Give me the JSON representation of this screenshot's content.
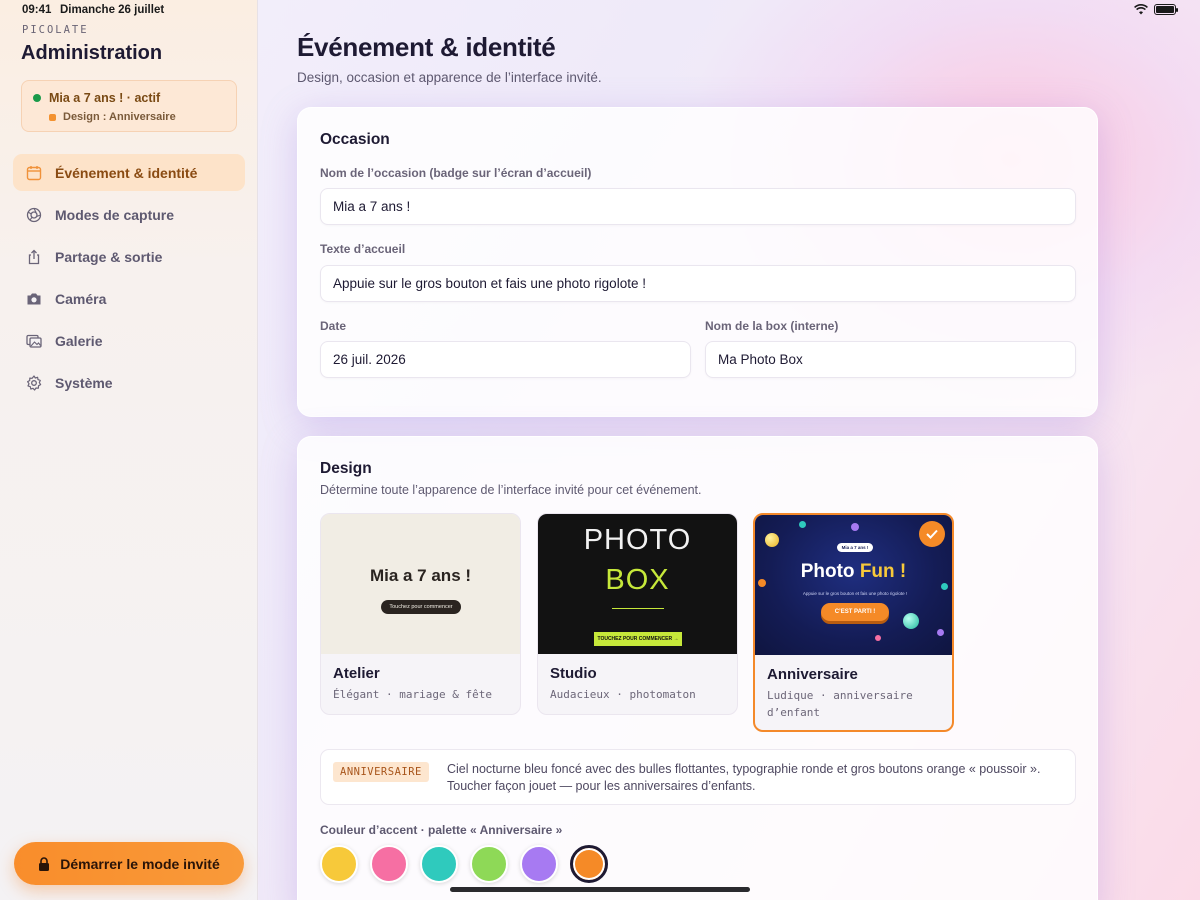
{
  "status": {
    "time": "09:41",
    "date": "Dimanche 26 juillet"
  },
  "sidebar": {
    "brand": "PICOLATE",
    "title": "Administration",
    "event": {
      "name": "Mia a 7 ans ! · actif",
      "design": "Design : Anniversaire"
    },
    "items": [
      {
        "label": "Événement & identité",
        "icon": "calendar-icon",
        "active": true
      },
      {
        "label": "Modes de capture",
        "icon": "aperture-icon"
      },
      {
        "label": "Partage & sortie",
        "icon": "share-icon"
      },
      {
        "label": "Caméra",
        "icon": "camera-icon"
      },
      {
        "label": "Galerie",
        "icon": "gallery-icon"
      },
      {
        "label": "Système",
        "icon": "gear-icon"
      }
    ],
    "guest_button": "Démarrer le mode invité"
  },
  "main": {
    "title": "Événement & identité",
    "subtitle": "Design, occasion et apparence de l’interface invité."
  },
  "occasion": {
    "heading": "Occasion",
    "name_label": "Nom de l’occasion (badge sur l’écran d’accueil)",
    "name_value": "Mia a 7 ans !",
    "welcome_label": "Texte d’accueil",
    "welcome_value": "Appuie sur le gros bouton et fais une photo rigolote !",
    "date_label": "Date",
    "date_value": "26 juil. 2026",
    "box_label": "Nom de la box (interne)",
    "box_value": "Ma Photo Box"
  },
  "design": {
    "heading": "Design",
    "description": "Détermine toute l’apparence de l’interface invité pour cet événement.",
    "themes": [
      {
        "name": "Atelier",
        "meta": "Élégant · mariage & fête",
        "thumb": {
          "title": "Mia a 7 ans !",
          "button": "Touchez pour commencer"
        }
      },
      {
        "name": "Studio",
        "meta": "Audacieux · photomaton",
        "thumb": {
          "line1": "PHOTO",
          "line2": "BOX",
          "button": "TOUCHEZ POUR COMMENCER →"
        }
      },
      {
        "name": "Anniversaire",
        "meta": "Ludique · anniversaire d’enfant",
        "selected": true,
        "thumb": {
          "chip": "Mia a 7 ans !",
          "title_a": "Photo ",
          "title_b": "Fun !",
          "text": "Appuie sur le gros bouton et fais une photo rigolote !",
          "button": "C’EST PARTI !"
        }
      }
    ],
    "info": {
      "badge": "ANNIVERSAIRE",
      "text": "Ciel nocturne bleu foncé avec des bulles flottantes, typographie ronde et gros boutons orange « poussoir ». Toucher façon jouet — pour les anniversaires d’enfants."
    },
    "accent_label": "Couleur d’accent · palette « Anniversaire »",
    "accent_colors": [
      "#f7c93a",
      "#f66fa3",
      "#2fcabd",
      "#8ed957",
      "#a77af2",
      "#f58a27"
    ],
    "selected_accent": "#f58a27"
  }
}
